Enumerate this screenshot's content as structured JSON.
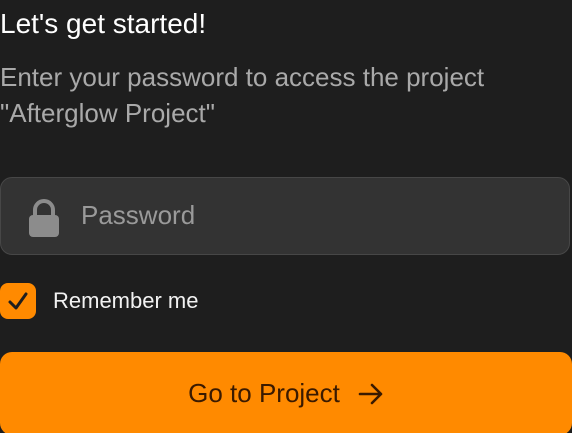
{
  "header": {
    "title": "Let's get started!",
    "subtitle": "Enter your password to access the project \"Afterglow Project\""
  },
  "form": {
    "password_placeholder": "Password",
    "password_value": "",
    "lock_icon": "lock-icon",
    "remember_label": "Remember me",
    "remember_checked": true,
    "submit_label": "Go to Project",
    "submit_icon": "arrow-right-icon"
  },
  "colors": {
    "background": "#1e1e1e",
    "accent": "#ff8a00",
    "input_background": "#333333",
    "button_text": "#3a1a00"
  }
}
